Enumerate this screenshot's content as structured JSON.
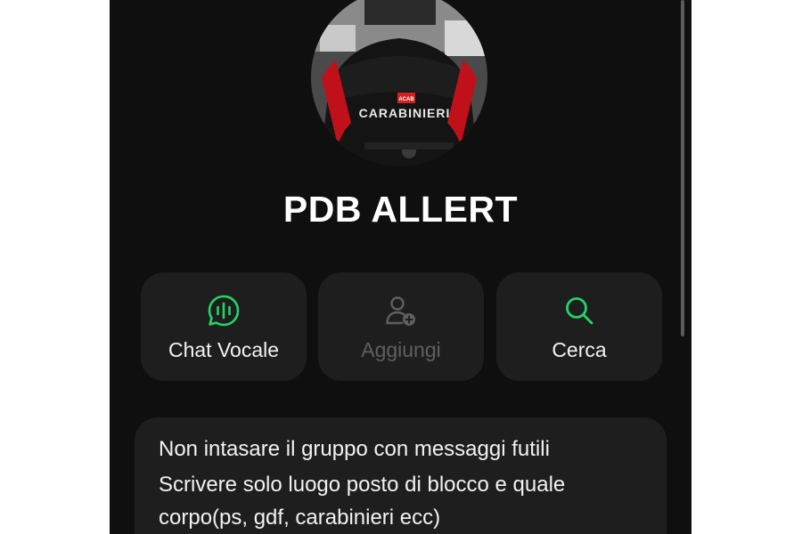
{
  "group": {
    "name": "PDB ALLERT",
    "avatar_text": "CARABINIERI",
    "avatar_badge": "ACAB"
  },
  "actions": [
    {
      "label": "Chat Vocale",
      "icon": "voice-chat-icon",
      "enabled": true
    },
    {
      "label": "Aggiungi",
      "icon": "add-person-icon",
      "enabled": false
    },
    {
      "label": "Cerca",
      "icon": "search-icon",
      "enabled": true
    }
  ],
  "description": {
    "lines": [
      "Non intasare il gruppo con messaggi futili",
      "Scrivere solo luogo posto di blocco e quale",
      "corpo(ps, gdf, carabinieri ecc)"
    ]
  },
  "colors": {
    "background": "#0f0f0f",
    "card": "#1e1e1e",
    "accent": "#25d366",
    "disabled": "#5f5f5f",
    "text": "#f2f2f2"
  }
}
